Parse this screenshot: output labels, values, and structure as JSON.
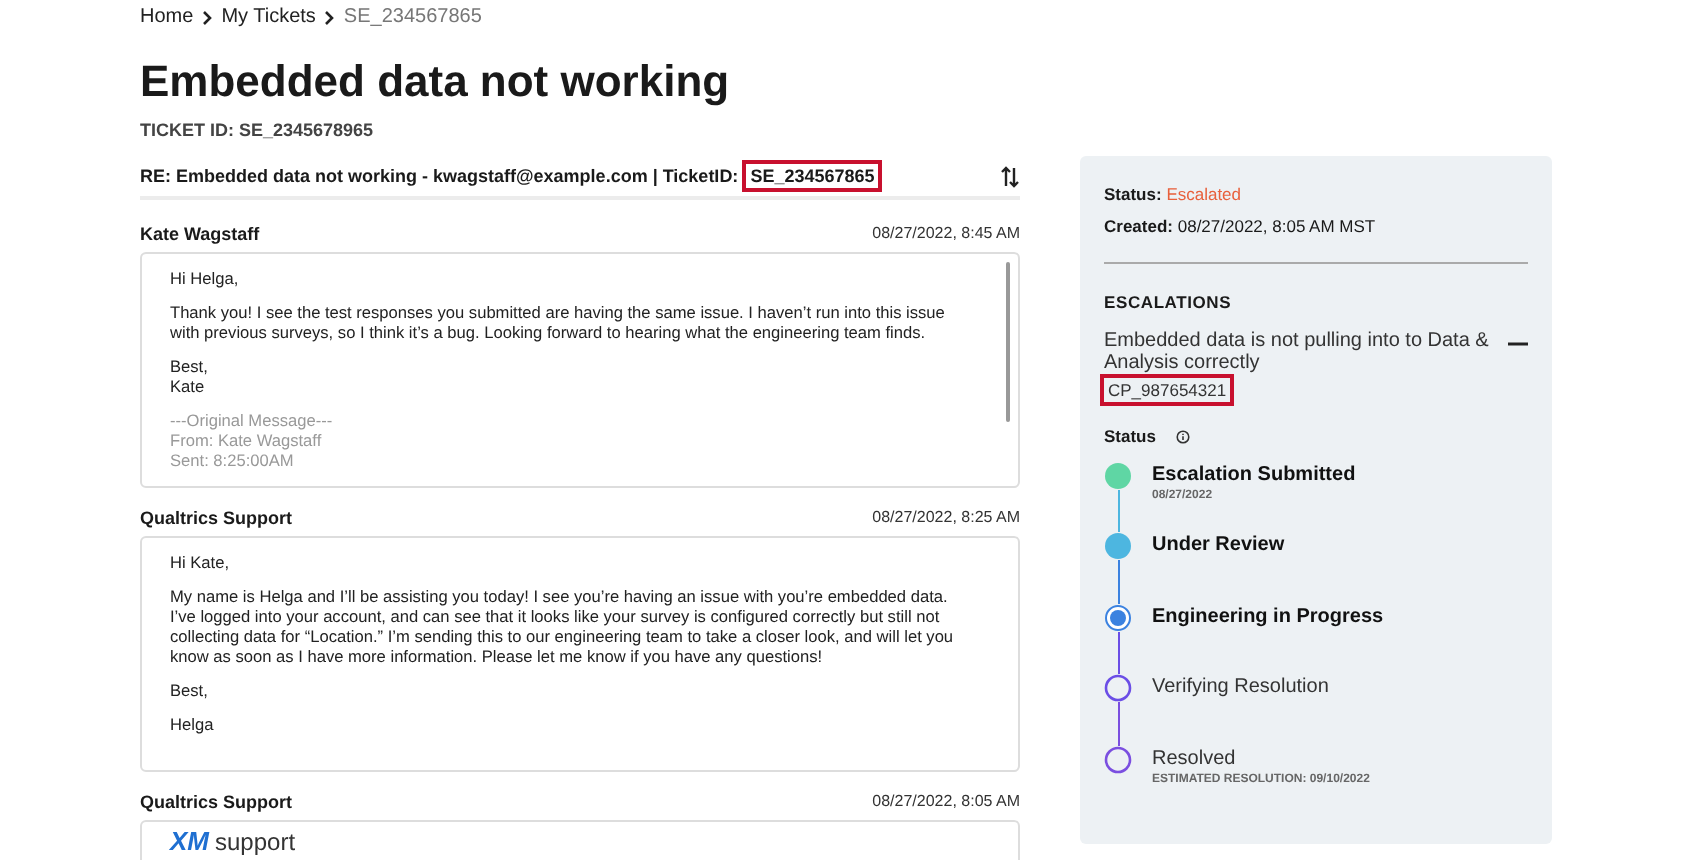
{
  "breadcrumbs": [
    {
      "label": "Home",
      "current": false
    },
    {
      "label": "My Tickets",
      "current": false
    },
    {
      "label": "SE_234567865",
      "current": true
    }
  ],
  "title": "Embedded data not working",
  "ticket_id": "TICKET ID: SE_2345678965",
  "thread": {
    "subject": "RE: Embedded data not working - kwagstaff@example.com | TicketID:",
    "subject_id": {
      "text": "SE_234567865",
      "highlighted": true
    },
    "messages": [
      {
        "sender": "Kate Wagstaff",
        "time": "08/27/2022, 8:45 AM",
        "kind": "text",
        "scrollable": true,
        "paragraphs": [
          {
            "lines": [
              "Hi Helga,"
            ],
            "faded": false
          },
          {
            "lines": [
              "Thank you! I see the test responses you submitted are having the same issue. I haven’t run into this issue with previous surveys, so I think it’s a bug. Looking forward to hearing what the engineering team finds."
            ],
            "faded": false
          },
          {
            "lines": [
              "Best,",
              "Kate"
            ],
            "faded": false
          },
          {
            "lines": [
              "---Original Message---",
              "From: Kate Wagstaff",
              "Sent: 8:25:00AM"
            ],
            "faded": true
          }
        ]
      },
      {
        "sender": "Qualtrics Support",
        "time": "08/27/2022, 8:25 AM",
        "kind": "text",
        "scrollable": false,
        "paragraphs": [
          {
            "lines": [
              "Hi Kate,"
            ],
            "faded": false
          },
          {
            "lines": [
              "My name is Helga and I’ll be assisting you today! I see you’re having an issue with you’re embedded data. I’ve logged into your account, and can see that it looks like your survey is configured correctly but still not collecting data for “Location.” I’m sending this to our engineering team to take a closer look, and will let you know as soon as I have more information. Please let me know if you have any questions!"
            ],
            "faded": false
          },
          {
            "lines": [
              "Best,"
            ],
            "faded": false
          },
          {
            "lines": [
              "Helga"
            ],
            "faded": false
          }
        ]
      },
      {
        "sender": "Qualtrics Support",
        "time": "08/27/2022, 8:05 AM",
        "kind": "logo",
        "logo": {
          "mark": "XM",
          "word": "support"
        }
      }
    ]
  },
  "details": {
    "status_label": "Status:",
    "status_value": "Escalated",
    "created_label": "Created:",
    "created_value": "08/27/2022, 8:05 AM MST",
    "escalations_heading": "ESCALATIONS",
    "escalation": {
      "title": "Embedded data is not pulling into to Data & Analysis correctly",
      "expanded": true,
      "id": {
        "text": "CP_987654321",
        "highlighted": true
      },
      "status_heading": "Status",
      "steps": [
        {
          "label": "Escalation Submitted",
          "note": "08/27/2022",
          "kind": "done",
          "color": "#5fd6a4"
        },
        {
          "label": "Under Review",
          "kind": "done",
          "color": "#4db6e0"
        },
        {
          "label": "Engineering in Progress",
          "kind": "current",
          "color": "#3b82e0"
        },
        {
          "label": "Verifying Resolution",
          "kind": "pending",
          "color": "#6b4ee6"
        },
        {
          "label": "Resolved",
          "note": "ESTIMATED RESOLUTION: 09/10/2022",
          "kind": "pending",
          "color": "#7b4fe0"
        }
      ]
    }
  }
}
